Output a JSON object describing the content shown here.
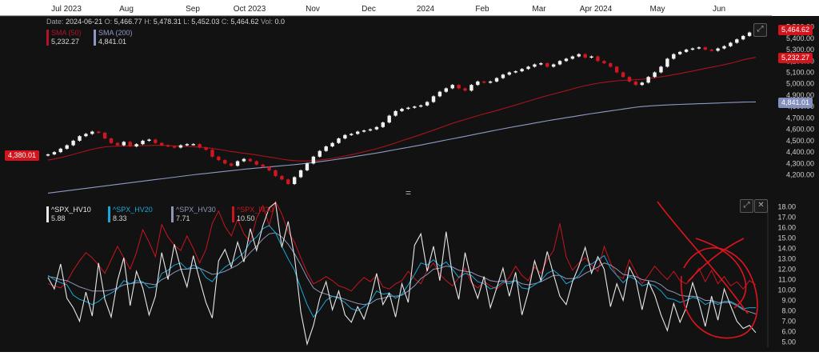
{
  "header": {
    "months": [
      "Jul 2023",
      "Aug",
      "Sep",
      "Oct 2023",
      "Nov",
      "Dec",
      "2024",
      "Feb",
      "Mar",
      "Apr 2024",
      "May",
      "Jun"
    ]
  },
  "ohlc": {
    "date_label": "Date:",
    "date": "2024-06-21",
    "o_label": "O:",
    "o": "5,466.77",
    "h_label": "H:",
    "h": "5,478.31",
    "l_label": "L:",
    "l": "5,452.03",
    "c_label": "C:",
    "c": "5,464.62",
    "vol_label": "Vol:",
    "vol": "0.0"
  },
  "price_legend": {
    "sma50": {
      "name": "SMA (50)",
      "value": "5,232.27",
      "color": "#b3122a"
    },
    "sma200": {
      "name": "SMA (200)",
      "value": "4,841.01",
      "color": "#8e9ac4"
    }
  },
  "price_tags": {
    "left": "4,380.01",
    "last": "5,464.62",
    "sma50": "5,232.27",
    "sma200": "4,841.01"
  },
  "price_axis": {
    "ticks": [
      "5,500.00",
      "5,400.00",
      "5,300.00",
      "5,200.00",
      "5,100.00",
      "5,000.00",
      "4,900.00",
      "4,800.00",
      "4,700.00",
      "4,600.00",
      "4,500.00",
      "4,400.00",
      "4,300.00",
      "4,200.00"
    ]
  },
  "vol_legend": [
    {
      "name": "^SPX_HV10",
      "value": "5.88",
      "color": "#e8e8e8"
    },
    {
      "name": "^SPX_HV20",
      "value": "8.33",
      "color": "#18a7d6"
    },
    {
      "name": "^SPX_HV30",
      "value": "7.71",
      "color": "#8f96b8"
    },
    {
      "name": "^SPX_IV30",
      "value": "10.50",
      "color": "#c8151f"
    }
  ],
  "vol_axis": {
    "ticks": [
      "18.00",
      "17.00",
      "16.00",
      "15.00",
      "14.00",
      "13.00",
      "12.00",
      "11.00",
      "10.00",
      "9.00",
      "8.00",
      "7.00",
      "6.00",
      "5.00"
    ]
  },
  "pane_buttons": {
    "expand": "⤢",
    "close": "✕",
    "separator": "="
  },
  "chart_data": [
    {
      "type": "candlestick",
      "title": "",
      "x_range": [
        "2023-06-21",
        "2024-06-21"
      ],
      "ylim": [
        4120,
        5560
      ],
      "closes": [
        4380,
        4400,
        4430,
        4460,
        4500,
        4540,
        4560,
        4580,
        4570,
        4520,
        4480,
        4460,
        4490,
        4450,
        4470,
        4500,
        4510,
        4480,
        4460,
        4450,
        4440,
        4460,
        4470,
        4470,
        4440,
        4420,
        4360,
        4330,
        4300,
        4280,
        4320,
        4340,
        4320,
        4290,
        4270,
        4240,
        4190,
        4160,
        4120,
        4180,
        4240,
        4300,
        4360,
        4410,
        4450,
        4480,
        4520,
        4550,
        4560,
        4580,
        4590,
        4600,
        4620,
        4660,
        4720,
        4760,
        4780,
        4790,
        4800,
        4810,
        4840,
        4890,
        4930,
        4960,
        4990,
        4960,
        4940,
        4990,
        5020,
        5010,
        5020,
        5050,
        5080,
        5100,
        5110,
        5130,
        5150,
        5170,
        5180,
        5150,
        5170,
        5200,
        5220,
        5240,
        5260,
        5230,
        5240,
        5200,
        5180,
        5150,
        5100,
        5060,
        5020,
        4990,
        5010,
        5060,
        5100,
        5150,
        5220,
        5260,
        5280,
        5300,
        5310,
        5320,
        5300,
        5290,
        5310,
        5330,
        5360,
        5390,
        5420,
        5450,
        5465
      ],
      "sma50": [
        4330,
        4340,
        4352,
        4365,
        4380,
        4395,
        4410,
        4425,
        4437,
        4445,
        4450,
        4452,
        4454,
        4455,
        4456,
        4457,
        4458,
        4459,
        4459,
        4458,
        4455,
        4452,
        4450,
        4447,
        4444,
        4440,
        4432,
        4424,
        4415,
        4405,
        4398,
        4390,
        4383,
        4375,
        4366,
        4357,
        4348,
        4338,
        4330,
        4325,
        4322,
        4322,
        4325,
        4330,
        4337,
        4345,
        4355,
        4366,
        4378,
        4390,
        4403,
        4416,
        4430,
        4446,
        4463,
        4481,
        4500,
        4518,
        4536,
        4554,
        4573,
        4593,
        4613,
        4633,
        4653,
        4670,
        4686,
        4703,
        4720,
        4735,
        4750,
        4765,
        4781,
        4797,
        4813,
        4830,
        4847,
        4864,
        4881,
        4896,
        4910,
        4925,
        4940,
        4955,
        4970,
        4983,
        4995,
        5005,
        5013,
        5020,
        5026,
        5030,
        5033,
        5036,
        5040,
        5046,
        5053,
        5061,
        5070,
        5080,
        5090,
        5101,
        5112,
        5123,
        5134,
        5145,
        5156,
        5168,
        5180,
        5195,
        5210,
        5222,
        5232
      ],
      "sma200": [
        4040,
        4047,
        4054,
        4061,
        4068,
        4075,
        4082,
        4089,
        4096,
        4103,
        4110,
        4117,
        4124,
        4131,
        4138,
        4145,
        4152,
        4159,
        4166,
        4173,
        4180,
        4187,
        4194,
        4201,
        4207,
        4213,
        4219,
        4225,
        4231,
        4237,
        4243,
        4249,
        4255,
        4260,
        4265,
        4270,
        4275,
        4280,
        4285,
        4290,
        4296,
        4302,
        4309,
        4316,
        4323,
        4331,
        4339,
        4347,
        4356,
        4365,
        4374,
        4383,
        4392,
        4402,
        4412,
        4422,
        4432,
        4442,
        4452,
        4462,
        4473,
        4484,
        4495,
        4506,
        4517,
        4528,
        4539,
        4550,
        4561,
        4572,
        4583,
        4594,
        4605,
        4615,
        4625,
        4635,
        4645,
        4655,
        4665,
        4675,
        4684,
        4693,
        4702,
        4711,
        4720,
        4729,
        4738,
        4746,
        4754,
        4762,
        4770,
        4778,
        4786,
        4794,
        4800,
        4804,
        4808,
        4811,
        4814,
        4817,
        4819,
        4821,
        4823,
        4825,
        4827,
        4829,
        4831,
        4833,
        4835,
        4837,
        4839,
        4840,
        4841
      ],
      "sma50_label": "SMA (50)",
      "sma200_label": "SMA (200)"
    },
    {
      "type": "line",
      "ylim": [
        4.5,
        18.5
      ],
      "series": [
        {
          "name": "^SPX_HV10",
          "values": [
            11.2,
            10.1,
            12.5,
            9.2,
            8.3,
            7.0,
            9.8,
            7.5,
            12.6,
            9.1,
            7.4,
            10.9,
            13.1,
            8.5,
            11.8,
            10.2,
            7.6,
            9.4,
            13.6,
            11.0,
            14.4,
            12.1,
            10.3,
            13.3,
            11.0,
            8.8,
            7.3,
            12.8,
            13.9,
            12.2,
            14.6,
            12.7,
            15.9,
            13.8,
            16.2,
            17.9,
            18.4,
            14.1,
            16.6,
            13.2,
            7.9,
            4.8,
            6.6,
            9.2,
            10.8,
            8.1,
            9.9,
            7.6,
            6.9,
            8.4,
            7.2,
            9.1,
            11.6,
            8.6,
            9.7,
            7.4,
            10.6,
            8.8,
            14.3,
            15.4,
            11.8,
            14.2,
            10.9,
            15.6,
            11.4,
            9.1,
            13.6,
            10.9,
            9.2,
            11.3,
            8.3,
            10.2,
            12.1,
            9.4,
            11.7,
            7.6,
            9.8,
            12.8,
            10.9,
            13.7,
            11.5,
            9.4,
            8.6,
            10.8,
            12.3,
            14.1,
            11.6,
            13.2,
            12.0,
            8.4,
            10.6,
            9.0,
            12.2,
            11.0,
            8.1,
            10.8,
            9.5,
            7.6,
            6.1,
            8.7,
            6.9,
            8.3,
            10.7,
            8.8,
            6.5,
            9.4,
            7.1,
            10.1,
            8.5,
            7.0,
            6.3,
            6.6,
            5.9
          ]
        },
        {
          "name": "^SPX_HV20",
          "values": [
            11.4,
            11.0,
            10.7,
            10.5,
            9.5,
            9.1,
            8.9,
            8.6,
            8.9,
            9.4,
            9.7,
            10.1,
            10.9,
            10.6,
            10.9,
            10.8,
            10.2,
            10.3,
            11.6,
            11.9,
            12.4,
            12.6,
            12.0,
            12.4,
            12.1,
            11.2,
            10.8,
            11.6,
            12.2,
            12.6,
            13.1,
            13.6,
            14.6,
            15.1,
            15.9,
            16.2,
            15.5,
            14.2,
            13.0,
            11.9,
            10.2,
            8.6,
            7.4,
            8.1,
            9.0,
            9.4,
            9.2,
            8.8,
            8.2,
            8.0,
            8.4,
            8.9,
            9.9,
            9.6,
            9.7,
            9.2,
            9.6,
            10.5,
            11.5,
            12.6,
            12.4,
            12.9,
            12.3,
            12.7,
            12.0,
            11.2,
            11.6,
            11.4,
            10.8,
            10.6,
            10.1,
            10.3,
            10.8,
            10.6,
            10.9,
            10.2,
            10.1,
            10.5,
            10.9,
            11.6,
            11.9,
            11.4,
            10.6,
            10.9,
            11.4,
            12.3,
            12.5,
            12.9,
            13.3,
            12.1,
            11.4,
            10.7,
            11.3,
            11.0,
            10.4,
            10.6,
            10.4,
            9.9,
            9.2,
            9.1,
            8.8,
            9.0,
            9.3,
            9.1,
            8.6,
            8.9,
            8.6,
            8.9,
            8.9,
            8.6,
            8.2,
            8.3,
            8.3
          ]
        },
        {
          "name": "^SPX_HV30",
          "values": [
            11.3,
            11.2,
            11.0,
            10.9,
            10.6,
            10.3,
            10.1,
            9.9,
            9.9,
            9.9,
            10.0,
            10.2,
            10.5,
            10.6,
            10.7,
            10.7,
            10.6,
            10.5,
            11.0,
            11.3,
            11.7,
            12.0,
            12.0,
            12.1,
            12.1,
            11.8,
            11.5,
            11.6,
            11.8,
            12.1,
            12.4,
            12.9,
            13.6,
            14.2,
            14.9,
            15.4,
            15.5,
            15.1,
            14.4,
            13.5,
            12.4,
            11.2,
            10.2,
            9.8,
            9.6,
            9.4,
            9.3,
            9.1,
            8.9,
            8.7,
            8.6,
            8.7,
            9.1,
            9.2,
            9.4,
            9.4,
            9.5,
            9.9,
            10.4,
            11.1,
            11.5,
            12.0,
            12.1,
            12.3,
            12.2,
            11.9,
            11.8,
            11.7,
            11.4,
            11.2,
            10.9,
            10.8,
            10.9,
            10.8,
            10.9,
            10.6,
            10.5,
            10.6,
            10.8,
            11.1,
            11.4,
            11.4,
            11.1,
            11.1,
            11.2,
            11.6,
            11.9,
            12.2,
            12.6,
            12.4,
            12.0,
            11.5,
            11.4,
            11.3,
            11.0,
            10.9,
            10.8,
            10.5,
            10.0,
            9.8,
            9.5,
            9.4,
            9.4,
            9.3,
            9.0,
            9.0,
            8.8,
            8.8,
            8.8,
            8.5,
            8.1,
            7.9,
            7.7
          ]
        },
        {
          "name": "^SPX_IV30",
          "values": [
            10.6,
            10.4,
            10.2,
            10.8,
            11.9,
            12.8,
            13.6,
            13.1,
            12.4,
            11.6,
            12.9,
            14.2,
            13.1,
            12.0,
            13.6,
            15.8,
            14.6,
            13.2,
            16.3,
            15.1,
            14.3,
            13.8,
            15.2,
            14.0,
            12.6,
            13.9,
            16.4,
            17.6,
            16.1,
            15.2,
            16.8,
            15.4,
            14.6,
            16.9,
            18.1,
            16.2,
            18.5,
            17.3,
            15.6,
            14.6,
            13.1,
            11.7,
            10.6,
            10.9,
            11.3,
            10.9,
            10.4,
            10.2,
            9.9,
            10.6,
            11.2,
            10.8,
            11.4,
            10.3,
            10.1,
            10.6,
            10.9,
            11.8,
            11.1,
            10.6,
            11.9,
            12.6,
            11.5,
            10.9,
            10.4,
            11.2,
            12.1,
            10.7,
            10.2,
            10.8,
            10.4,
            10.1,
            10.6,
            11.2,
            12.3,
            11.4,
            10.9,
            12.2,
            11.6,
            12.9,
            13.8,
            16.4,
            13.2,
            11.9,
            12.6,
            13.1,
            12.4,
            11.8,
            14.2,
            12.6,
            11.4,
            11.1,
            12.9,
            11.7,
            10.6,
            11.4,
            12.3,
            11.6,
            11.0,
            11.8,
            10.9,
            10.6,
            11.2,
            12.1,
            10.8,
            11.9,
            10.6,
            11.3,
            10.4,
            10.8,
            10.1,
            10.9,
            10.5
          ]
        }
      ]
    }
  ]
}
